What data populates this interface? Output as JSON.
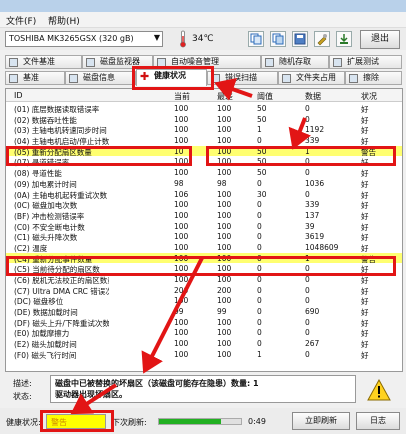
{
  "window": {
    "title": "HD Tune Pro 4.61",
    "menu": [
      "文件(F)",
      "帮助(H)"
    ]
  },
  "toolbar": {
    "drive": "TOSHIBA MK3265GSX (320 gB)",
    "temperature": "34℃",
    "exit_label": "退出"
  },
  "tabs": {
    "row1": [
      "文件基准",
      "磁盘监视器",
      "自动噪音管理",
      "随机存取",
      "扩展测试"
    ],
    "row2": [
      "基准",
      "磁盘信息",
      "健康状况",
      "错误扫描",
      "文件夹占用",
      "擦除"
    ],
    "active": "健康状况"
  },
  "table": {
    "headers": [
      "ID",
      "当前",
      "最差",
      "阈值",
      "数据",
      "状况"
    ],
    "rows": [
      {
        "id": "(01) 底层数据读取错误率",
        "cur": "100",
        "worst": "100",
        "thr": "50",
        "raw": "0",
        "status": "好",
        "warn": false
      },
      {
        "id": "(02) 数据吞吐性能",
        "cur": "100",
        "worst": "100",
        "thr": "50",
        "raw": "0",
        "status": "好",
        "warn": false
      },
      {
        "id": "(03) 主轴电机转速同步时间",
        "cur": "100",
        "worst": "100",
        "thr": "1",
        "raw": "1192",
        "status": "好",
        "warn": false
      },
      {
        "id": "(04) 主轴电机启动/停止计数",
        "cur": "100",
        "worst": "100",
        "thr": "0",
        "raw": "339",
        "status": "好",
        "warn": false
      },
      {
        "id": "(05) 重新分配扇区数量",
        "cur": "10",
        "worst": "100",
        "thr": "50",
        "raw": "1",
        "status": "警告",
        "warn": true
      },
      {
        "id": "(07) 寻道错误率",
        "cur": "100",
        "worst": "100",
        "thr": "50",
        "raw": "0",
        "status": "好",
        "warn": false
      },
      {
        "id": "(08) 寻道性能",
        "cur": "100",
        "worst": "100",
        "thr": "50",
        "raw": "0",
        "status": "好",
        "warn": false
      },
      {
        "id": "(09) 加电累计时间",
        "cur": "98",
        "worst": "98",
        "thr": "0",
        "raw": "1036",
        "status": "好",
        "warn": false
      },
      {
        "id": "(0A) 主轴电机起转重试次数",
        "cur": "106",
        "worst": "100",
        "thr": "30",
        "raw": "0",
        "status": "好",
        "warn": false
      },
      {
        "id": "(0C) 磁盘加电次数",
        "cur": "100",
        "worst": "100",
        "thr": "0",
        "raw": "339",
        "status": "好",
        "warn": false
      },
      {
        "id": "(BF) 冲击检测错误率",
        "cur": "100",
        "worst": "100",
        "thr": "0",
        "raw": "137",
        "status": "好",
        "warn": false
      },
      {
        "id": "(C0) 不安全断电计数",
        "cur": "100",
        "worst": "100",
        "thr": "0",
        "raw": "39",
        "status": "好",
        "warn": false
      },
      {
        "id": "(C1) 磁头升降次数",
        "cur": "100",
        "worst": "100",
        "thr": "0",
        "raw": "3619",
        "status": "好",
        "warn": false
      },
      {
        "id": "(C2) 温度",
        "cur": "100",
        "worst": "100",
        "thr": "0",
        "raw": "1048609",
        "status": "好",
        "warn": false
      },
      {
        "id": "(C4) 重新分配事件数量",
        "cur": "100",
        "worst": "100",
        "thr": "0",
        "raw": "1",
        "status": "警告",
        "warn": true
      },
      {
        "id": "(C5) 当前待分配的扇区数",
        "cur": "100",
        "worst": "100",
        "thr": "0",
        "raw": "0",
        "status": "好",
        "warn": false
      },
      {
        "id": "(C6) 脱机无法校正的扇区数量",
        "cur": "100",
        "worst": "100",
        "thr": "0",
        "raw": "0",
        "status": "好",
        "warn": false
      },
      {
        "id": "(C7) Ultra DMA CRC 错误次数",
        "cur": "200",
        "worst": "200",
        "thr": "0",
        "raw": "0",
        "status": "好",
        "warn": false
      },
      {
        "id": "(DC) 磁盘移位",
        "cur": "100",
        "worst": "100",
        "thr": "0",
        "raw": "0",
        "status": "好",
        "warn": false
      },
      {
        "id": "(DE) 数据加载时间",
        "cur": "99",
        "worst": "99",
        "thr": "0",
        "raw": "690",
        "status": "好",
        "warn": false
      },
      {
        "id": "(DF) 磁头上升/下降重试次数",
        "cur": "100",
        "worst": "100",
        "thr": "0",
        "raw": "0",
        "status": "好",
        "warn": false
      },
      {
        "id": "(E0) 加载摩擦力",
        "cur": "100",
        "worst": "100",
        "thr": "0",
        "raw": "0",
        "status": "好",
        "warn": false
      },
      {
        "id": "(E2) 磁头加载时间",
        "cur": "100",
        "worst": "100",
        "thr": "0",
        "raw": "267",
        "status": "好",
        "warn": false
      },
      {
        "id": "(F0) 磁头飞行时间",
        "cur": "100",
        "worst": "100",
        "thr": "1",
        "raw": "0",
        "status": "好",
        "warn": false
      }
    ]
  },
  "details": {
    "desc_label": "描述:",
    "status_label": "状态:",
    "desc_text": "磁盘中已被替换的坏扇区（该磁盘可能存在隐患）数量: 1",
    "status_text": "驱动器出现坏扇区。"
  },
  "status_bar": {
    "health_label": "健康状况:",
    "health_value": "警告",
    "refresh_label": "下次刷新:",
    "progress_pct": 0.75,
    "time": "0:49",
    "refresh_btn": "立即刷新",
    "log_btn": "日志"
  },
  "colors": {
    "warn_row": "#ffff70",
    "highlight": "#e21515",
    "health_bg": "#ffff00"
  }
}
